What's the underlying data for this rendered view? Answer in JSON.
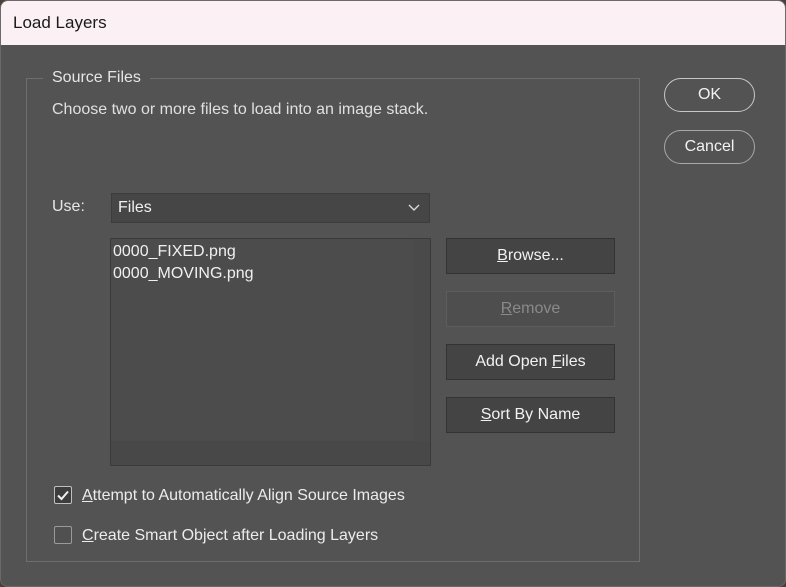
{
  "window": {
    "title": "Load Layers"
  },
  "source_files": {
    "legend": "Source Files",
    "description": "Choose two or more files to load into an image stack.",
    "use_label": "Use:",
    "use_select": {
      "value": "Files",
      "icon": "chevron-down-icon"
    },
    "files": [
      "0000_FIXED.png",
      "0000_MOVING.png"
    ],
    "buttons": {
      "browse": {
        "pre": "",
        "ul": "B",
        "post": "rowse..."
      },
      "remove": {
        "pre": "",
        "ul": "R",
        "post": "emove"
      },
      "add_open_files": {
        "pre": "Add Open ",
        "ul": "F",
        "post": "iles"
      },
      "sort_by_name": {
        "pre": "",
        "ul": "S",
        "post": "ort By Name"
      }
    }
  },
  "options": {
    "auto_align": {
      "ul": "A",
      "rest": "ttempt to Automatically Align Source Images",
      "checked": true
    },
    "smart_object": {
      "ul": "C",
      "rest": "reate Smart Object after Loading Layers",
      "checked": false
    }
  },
  "dialog_buttons": {
    "ok": "OK",
    "cancel": "Cancel"
  }
}
